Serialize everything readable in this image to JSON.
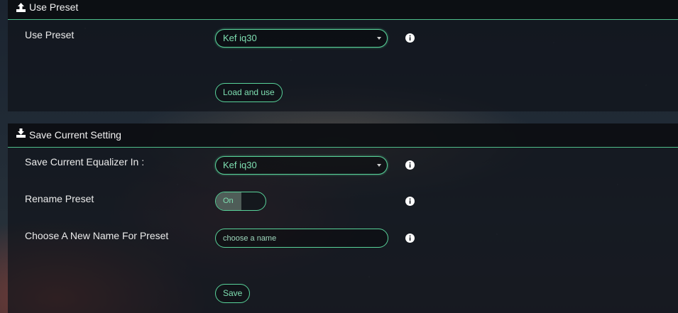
{
  "use_preset": {
    "header_title": "Use Preset",
    "header_icon": "upload-icon",
    "label": "Use Preset",
    "selected_preset": "Kef iq30",
    "load_button": "Load and use",
    "info_icon": "info-icon"
  },
  "save_setting": {
    "header_title": "Save Current Setting",
    "header_icon": "download-icon",
    "save_in_label": "Save Current Equalizer In :",
    "save_in_selected": "Kef iq30",
    "rename_label": "Rename Preset",
    "rename_toggle_on_text": "On",
    "rename_enabled": true,
    "new_name_label": "Choose A New Name For Preset",
    "new_name_placeholder": "choose a name",
    "new_name_value": "",
    "save_button": "Save",
    "info_icon": "info-icon"
  },
  "colors": {
    "accent": "#58d39a",
    "accent_text": "#7fe0b2",
    "panel_bg": "#10141a"
  }
}
